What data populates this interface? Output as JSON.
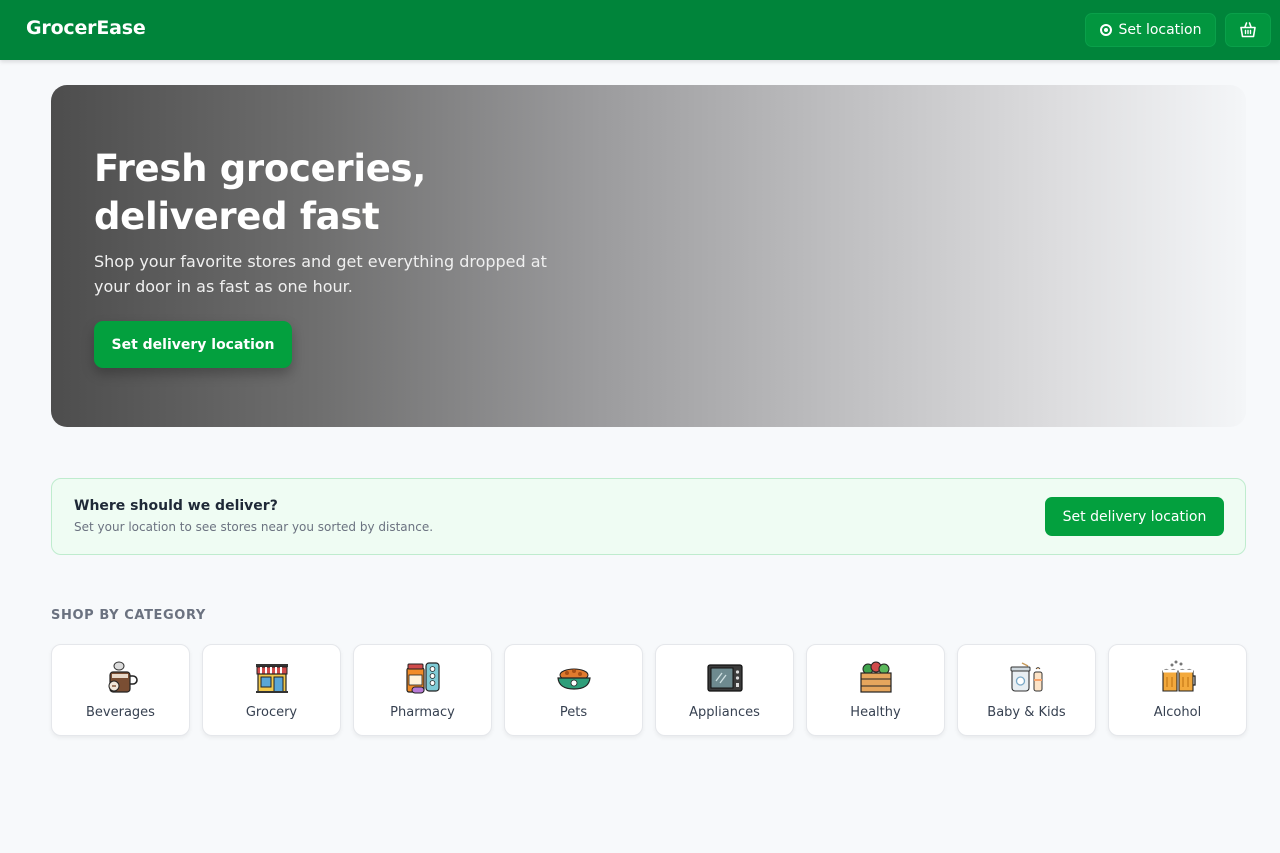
{
  "header": {
    "brand": "GrocerEase",
    "set_location_label": "Set location",
    "accent_color": "#00843a"
  },
  "hero": {
    "title_line1": "Fresh groceries,",
    "title_line2": "delivered fast",
    "subtitle": "Shop your favorite stores and get everything dropped at your door in as fast as one hour.",
    "button_label": "Set delivery location"
  },
  "delivery": {
    "title": "Where should we deliver?",
    "subtitle": "Set your location to see stores near you sorted by distance.",
    "button_label": "Set delivery location"
  },
  "categories": {
    "heading": "SHOP BY CATEGORY",
    "items": [
      {
        "label": "Beverages",
        "icon": "coffee-cup-icon"
      },
      {
        "label": "Grocery",
        "icon": "storefront-icon"
      },
      {
        "label": "Pharmacy",
        "icon": "medicine-icon"
      },
      {
        "label": "Pets",
        "icon": "pet-bowl-icon"
      },
      {
        "label": "Appliances",
        "icon": "microwave-icon"
      },
      {
        "label": "Healthy",
        "icon": "vegetable-crate-icon"
      },
      {
        "label": "Baby & Kids",
        "icon": "baby-bottle-icon"
      },
      {
        "label": "Alcohol",
        "icon": "beer-mugs-icon"
      }
    ]
  }
}
